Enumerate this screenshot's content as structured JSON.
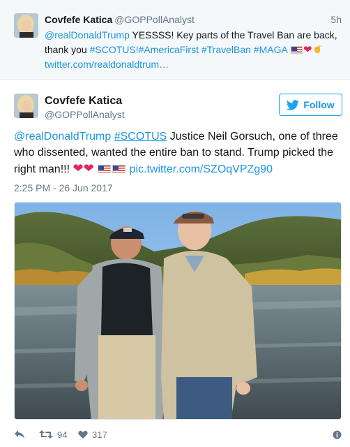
{
  "parent_tweet": {
    "name": "Covfefe Katica",
    "handle": "@GOPPollAnalyst",
    "time": "5h",
    "text_parts": {
      "mention": "@realDonaldTrump",
      "body": " YESSSS! Key parts of the Travel Ban are back, thank you ",
      "hashtags": "#SCOTUS!#AmericaFirst #TravelBan #MAGA",
      "link": "twitter.com/realdonaldtrum…"
    }
  },
  "main_tweet": {
    "name": "Covfefe Katica",
    "handle": "@GOPPollAnalyst",
    "follow_label": "Follow",
    "text_parts": {
      "mention": "@realDonaldTrump",
      "hashtag": "#SCOTUS",
      "body": " Justice Neil Gorsuch, one of three who dissented, wanted the entire ban to stand. Trump picked the right man!!! ",
      "link": "pic.twitter.com/SZOqVPZg90"
    },
    "timestamp": "2:25 PM - 26 Jun 2017",
    "actions": {
      "retweet_count": "94",
      "like_count": "317"
    }
  },
  "icons": {
    "follow": "twitter-bird-icon",
    "reply": "reply-icon",
    "retweet": "retweet-icon",
    "like": "heart-icon",
    "info": "info-icon",
    "emoji": [
      "us-flag-icon",
      "red-heart-icon",
      "clapping-hand-icon"
    ]
  },
  "colors": {
    "link": "#1b95e0",
    "text": "#14171a",
    "secondary": "#657786",
    "parent_bg": "#f5f8fa",
    "heart": "#e0245e"
  }
}
